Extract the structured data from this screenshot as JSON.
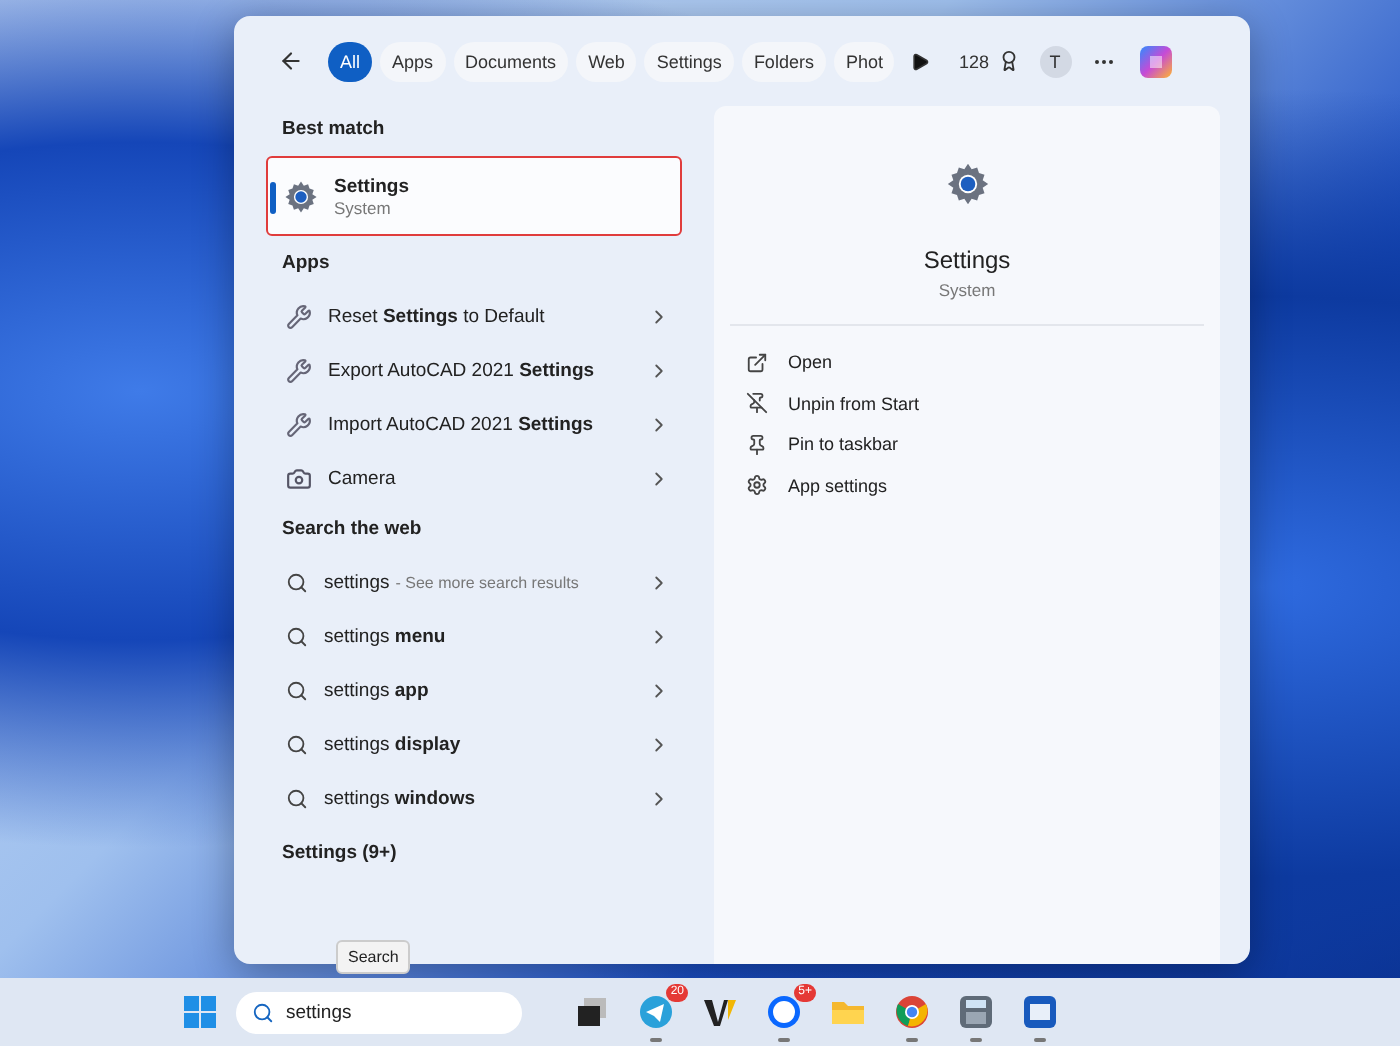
{
  "filter_tabs": [
    {
      "label": "All",
      "selected": true
    },
    {
      "label": "Apps",
      "selected": false
    },
    {
      "label": "Documents",
      "selected": false
    },
    {
      "label": "Web",
      "selected": false
    },
    {
      "label": "Settings",
      "selected": false
    },
    {
      "label": "Folders",
      "selected": false
    },
    {
      "label": "Phot",
      "selected": false
    }
  ],
  "toolbar": {
    "points": "128",
    "avatar": "T"
  },
  "best_match": {
    "heading": "Best match",
    "title": "Settings",
    "subtitle": "System",
    "selected": true
  },
  "apps": {
    "heading": "Apps",
    "items": [
      {
        "label": "Reset **Settings** to Default",
        "kind": "reset"
      },
      {
        "label": "Export AutoCAD 2021 **Settings**",
        "kind": "export"
      },
      {
        "label": "Import AutoCAD 2021 **Settings**",
        "kind": "import"
      },
      {
        "label": "Camera",
        "kind": "camera"
      }
    ]
  },
  "web": {
    "heading": "Search the web",
    "items": [
      {
        "label": "settings",
        "hint": "- See more search results"
      },
      {
        "label": "settings **menu**"
      },
      {
        "label": "settings **app**"
      },
      {
        "label": "settings **display**"
      },
      {
        "label": "settings **windows**"
      }
    ]
  },
  "more": "Settings (9+)",
  "preview": {
    "title": "Settings",
    "subtitle": "System",
    "actions": [
      {
        "label": "Open",
        "kind": "open"
      },
      {
        "label": "Unpin from Start",
        "kind": "unpin"
      },
      {
        "label": "Pin to taskbar",
        "kind": "pin"
      },
      {
        "label": "App settings",
        "kind": "settings"
      }
    ]
  },
  "tooltip": "Search",
  "taskbar": {
    "search_value": "settings",
    "apps": [
      {
        "kind": "taskview",
        "running": false
      },
      {
        "kind": "telegram",
        "badge": "20",
        "running": true
      },
      {
        "kind": "wps",
        "running": false
      },
      {
        "kind": "zalo",
        "badge": "5+",
        "running": true
      },
      {
        "kind": "folder",
        "running": false
      },
      {
        "kind": "chrome",
        "running": true
      },
      {
        "kind": "calculator",
        "running": true
      },
      {
        "kind": "word",
        "running": true
      }
    ]
  }
}
